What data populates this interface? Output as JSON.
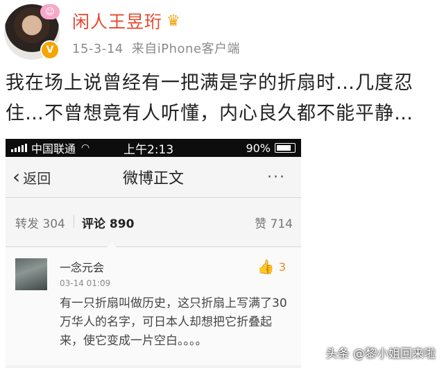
{
  "post": {
    "username": "闲人王昱珩",
    "date": "15-3-14",
    "source": "来自iPhone客户端",
    "text": "我在场上说曾经有一把满是字的折扇时…几度忍住…不曾想竟有人听懂，内心良久都不能平静…"
  },
  "icons": {
    "avatar_badge": "smile-badge-icon",
    "verified": "verified-v-icon",
    "crown": "crown-icon"
  },
  "screenshot": {
    "statusbar": {
      "carrier": "中国联通",
      "time": "上午2:13",
      "battery": "90%"
    },
    "nav": {
      "back": "返回",
      "title": "微博正文",
      "more": "···"
    },
    "tabs": {
      "repost": "转发 304",
      "comment": "评论 890",
      "like": "赞 714"
    },
    "comment": {
      "name": "一念元会",
      "time": "03-14 01:09",
      "likes": "3",
      "text": "有一只折扇叫做历史，这只折扇上写满了30万华人的名字，可日本人却想把它折叠起来，使它变成一片空白。。。。"
    }
  },
  "watermark": "头条 @黎小姐回来啦",
  "colors": {
    "username": "#e5472d",
    "meta": "#8a8a8a",
    "like_accent": "#f29a20"
  }
}
